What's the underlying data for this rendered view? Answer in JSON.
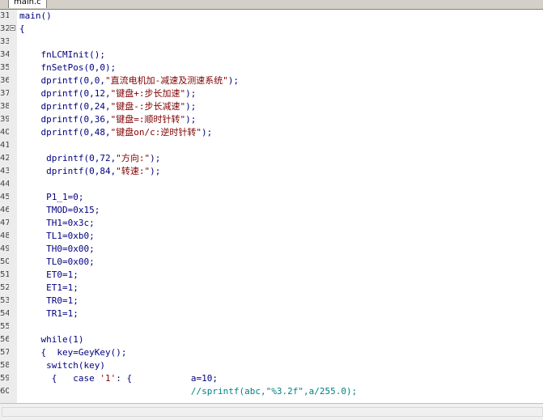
{
  "tab": {
    "label": "main.c"
  },
  "lines": [
    {
      "no": "31",
      "code": "main()"
    },
    {
      "no": "32",
      "code": "{",
      "fold": true
    },
    {
      "no": "33",
      "code": ""
    },
    {
      "no": "34",
      "code": "    fnLCMInit();"
    },
    {
      "no": "35",
      "code": "    fnSetPos(0,0);"
    },
    {
      "no": "36",
      "code": "    dprintf(0,0,\"直流电机加-减速及测速系统\");"
    },
    {
      "no": "37",
      "code": "    dprintf(0,12,\"键盘+:步长加速\");"
    },
    {
      "no": "38",
      "code": "    dprintf(0,24,\"键盘-:步长减速\");"
    },
    {
      "no": "39",
      "code": "    dprintf(0,36,\"键盘=:顺时针转\");"
    },
    {
      "no": "40",
      "code": "    dprintf(0,48,\"键盘on/c:逆时针转\");"
    },
    {
      "no": "41",
      "code": ""
    },
    {
      "no": "42",
      "code": "     dprintf(0,72,\"方向:\");"
    },
    {
      "no": "43",
      "code": "     dprintf(0,84,\"转速:\");"
    },
    {
      "no": "44",
      "code": ""
    },
    {
      "no": "45",
      "code": "     P1_1=0;"
    },
    {
      "no": "46",
      "code": "     TMOD=0x15;"
    },
    {
      "no": "47",
      "code": "     TH1=0x3c;"
    },
    {
      "no": "48",
      "code": "     TL1=0xb0;"
    },
    {
      "no": "49",
      "code": "     TH0=0x00;"
    },
    {
      "no": "50",
      "code": "     TL0=0x00;"
    },
    {
      "no": "51",
      "code": "     ET0=1;"
    },
    {
      "no": "52",
      "code": "     ET1=1;"
    },
    {
      "no": "53",
      "code": "     TR0=1;"
    },
    {
      "no": "54",
      "code": "     TR1=1;"
    },
    {
      "no": "55",
      "code": ""
    },
    {
      "no": "56",
      "code": "    while(1)"
    },
    {
      "no": "57",
      "code": "    {  key=GeyKey();"
    },
    {
      "no": "58",
      "code": "     switch(key)"
    },
    {
      "no": "59",
      "code": "      {   case '1': {           a=10;"
    },
    {
      "no": "60",
      "code": "                                //sprintf(abc,\"%3.2f\",a/255.0);"
    }
  ],
  "colors": {
    "code": "#000080",
    "string": "#800000",
    "comment": "#008080",
    "gutter": "#ececec"
  }
}
